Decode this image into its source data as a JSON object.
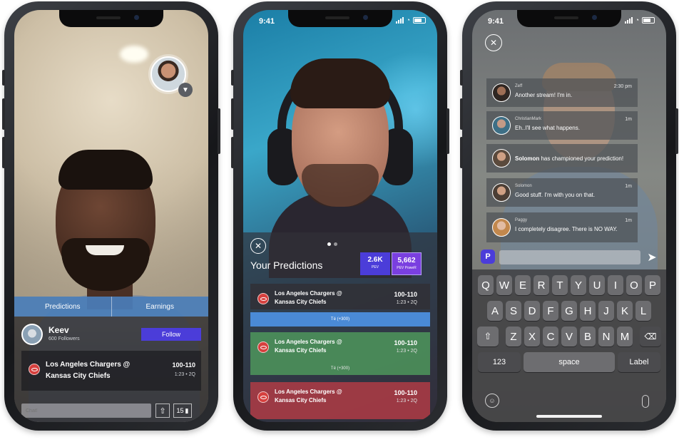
{
  "phone1": {
    "tabs": [
      "Predictions",
      "Earnings"
    ],
    "user": {
      "name": "Keev",
      "followers": "600 Followers",
      "follow_label": "Follow"
    },
    "game": {
      "teams_line1": "Los Angeles Chargers @",
      "teams_line2": "Kansas City Chiefs",
      "score": "100-110",
      "meta": "1:23 • 2Q"
    },
    "chat_placeholder": "Chat!",
    "likes": "15",
    "icons": {
      "share": "share-icon",
      "like": "thumbs-up-icon",
      "chevron": "chevron-down-icon"
    },
    "colors": {
      "tab_bar": "#4a7eba",
      "follow": "#4b3dd9"
    }
  },
  "phone2": {
    "status_time": "9:41",
    "title": "Your Predictions",
    "stats": [
      {
        "value": "2.6K",
        "label": "PEV"
      },
      {
        "value": "5,662",
        "label": "PEV PoweR"
      }
    ],
    "predictions": [
      {
        "teams_line1": "Los Angeles Chargers @",
        "teams_line2": "Kansas City Chiefs",
        "score": "100-110",
        "meta": "1:23 • 2Q",
        "pick": "Té (+300)",
        "status": "pending"
      },
      {
        "teams_line1": "Los Angeles Chargers @",
        "teams_line2": "Kansas City Chiefs",
        "score": "100-110",
        "meta": "1:23 • 2Q",
        "pick": "Té (+300)",
        "status": "won"
      },
      {
        "teams_line1": "Los Angeles Chargers @",
        "teams_line2": "Kansas City Chiefs",
        "score": "100-110",
        "meta": "1:23 • 2Q",
        "status": "lost"
      }
    ],
    "colors": {
      "pending": "#4a8ad6",
      "won": "#4e965c",
      "lost": "#b43c46"
    }
  },
  "phone3": {
    "status_time": "9:41",
    "messages": [
      {
        "name": "Zeff",
        "text": "Another stream! I'm in.",
        "time": "2:30 pm"
      },
      {
        "name": "ChristianMark",
        "text": "Eh..I'll see what happens.",
        "time": "1m"
      },
      {
        "bold": "Solomon",
        "text": " has championed your prediction!"
      },
      {
        "name": "Solomon",
        "text": "Good stuff. I'm with you on that.",
        "time": "1m"
      },
      {
        "name": "Paggy",
        "text": "I completely disagree. There is NO WAY.",
        "time": "1m"
      }
    ],
    "badge": "P",
    "keyboard": {
      "row1": [
        "Q",
        "W",
        "E",
        "R",
        "T",
        "Y",
        "U",
        "I",
        "O",
        "P"
      ],
      "row2": [
        "A",
        "S",
        "D",
        "F",
        "G",
        "H",
        "J",
        "K",
        "L"
      ],
      "row3": [
        "Z",
        "X",
        "C",
        "V",
        "B",
        "N",
        "M"
      ],
      "numbers": "123",
      "space": "space",
      "label": "Label"
    }
  }
}
